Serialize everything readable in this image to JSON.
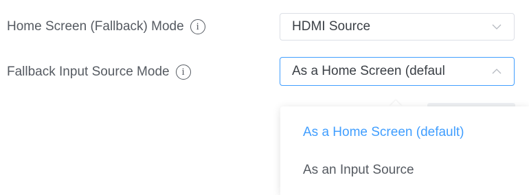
{
  "settings": {
    "home_screen_mode": {
      "label": "Home Screen (Fallback) Mode",
      "value": "HDMI Source",
      "info_glyph": "i"
    },
    "fallback_input_mode": {
      "label": "Fallback Input Source Mode",
      "value": "As a Home Screen (defaul",
      "info_glyph": "i",
      "options": [
        "As a Home Screen (default)",
        "As an Input Source"
      ]
    }
  },
  "colors": {
    "accent": "#409eff",
    "label": "#555a61",
    "text": "#3a3f45",
    "border": "#dcdfe6"
  }
}
